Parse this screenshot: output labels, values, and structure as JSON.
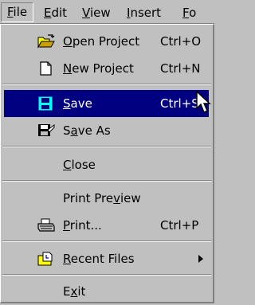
{
  "menubar": {
    "items": [
      {
        "label": "File",
        "key": "F",
        "rest": "ile"
      },
      {
        "label": "Edit",
        "key": "E",
        "rest": "dit"
      },
      {
        "label": "View",
        "key": "V",
        "rest": "iew"
      },
      {
        "label": "Insert",
        "key": "I",
        "rest": "nsert"
      },
      {
        "label": "Fo",
        "key": "F",
        "rest": "o"
      }
    ]
  },
  "file_menu": {
    "open_project": {
      "pre": "",
      "key": "O",
      "rest": "pen Project",
      "shortcut": "Ctrl+O",
      "icon": "open-folder-icon"
    },
    "new_project": {
      "pre": "",
      "key": "N",
      "rest": "ew Project",
      "shortcut": "Ctrl+N",
      "icon": "new-document-icon"
    },
    "save": {
      "pre": "",
      "key": "S",
      "rest": "ave",
      "shortcut": "Ctrl+S",
      "icon": "floppy-disk-icon",
      "selected": true
    },
    "save_as": {
      "pre": "S",
      "key": "a",
      "rest": "ve As",
      "shortcut": "",
      "icon": "save-as-icon"
    },
    "close": {
      "pre": "",
      "key": "C",
      "rest": "lose",
      "shortcut": ""
    },
    "print_preview": {
      "pre": "Print Pre",
      "key": "v",
      "rest": "iew",
      "shortcut": ""
    },
    "print": {
      "pre": "",
      "key": "P",
      "rest": "rint...",
      "shortcut": "Ctrl+P",
      "icon": "printer-icon"
    },
    "recent_files": {
      "pre": "",
      "key": "R",
      "rest": "ecent Files",
      "shortcut": "",
      "icon": "recent-files-icon",
      "has_submenu": true
    },
    "exit": {
      "pre": "E",
      "key": "x",
      "rest": "it",
      "shortcut": ""
    }
  },
  "colors": {
    "menu_bg": "#c0c0c0",
    "highlight_bg": "#000080",
    "highlight_text": "#ffffff"
  }
}
